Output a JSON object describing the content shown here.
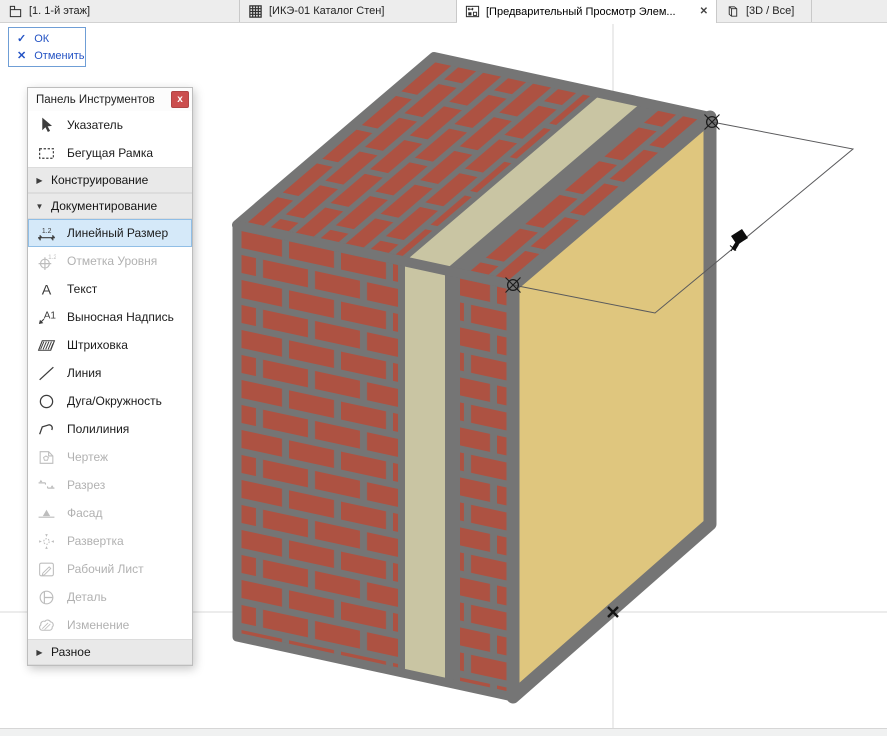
{
  "glyphs": {
    "check": "✓",
    "cross": "✕",
    "collapsed": "▶",
    "expanded": "▼",
    "close_x": "x",
    "tab_close": "✕"
  },
  "colors": {
    "brick": "#ad5242",
    "mortar": "#757575",
    "beige": "#c9c5a3",
    "yellowface": "#dfc67e",
    "guide": "#d9d9d9",
    "rubber": "#5a5a5c",
    "blue": "#2453c4",
    "selbg": "#d5e9f9",
    "selborder": "#90bee6",
    "closered": "#cb4e4e"
  },
  "tab_bar": {
    "tabs": [
      {
        "name": "floor-plan",
        "label": "[1. 1-й этаж]",
        "icon": "story-icon",
        "symbol": "i-story",
        "active": false,
        "closable": false
      },
      {
        "name": "wall-catalog",
        "label": "[ИКЭ-01 Каталог Стен]",
        "icon": "schedule-grid-icon",
        "symbol": "i-grid",
        "active": false,
        "closable": false
      },
      {
        "name": "element-preview",
        "label": "[Предварительный Просмотр Элем...",
        "icon": "preview-icon",
        "symbol": "i-preview",
        "active": true,
        "closable": true
      },
      {
        "name": "3d-all",
        "label": "[3D / Все]",
        "icon": "3d-view-icon",
        "symbol": "i-3d",
        "active": false,
        "closable": false
      }
    ]
  },
  "confirm_popup": {
    "ok_label": "ОК",
    "cancel_label": "Отменить"
  },
  "tool_panel": {
    "title": "Панель Инструментов",
    "items": [
      {
        "type": "tool",
        "name": "pointer",
        "label": "Указатель",
        "icon": "pointer-icon",
        "symbol": "i-pointer",
        "enabled": true,
        "selected": false
      },
      {
        "type": "tool",
        "name": "marquee",
        "label": "Бегущая Рамка",
        "icon": "marquee-icon",
        "symbol": "i-marquee",
        "enabled": true,
        "selected": false
      },
      {
        "type": "section",
        "name": "design",
        "label": "Конструирование",
        "expanded": false
      },
      {
        "type": "section",
        "name": "documentation",
        "label": "Документирование",
        "expanded": true
      },
      {
        "type": "tool",
        "name": "linear-dimension",
        "label": "Линейный Размер",
        "icon": "linear-dimension-icon",
        "symbol": "i-lineardim",
        "enabled": true,
        "selected": true
      },
      {
        "type": "tool",
        "name": "level-dimension",
        "label": "Отметка Уровня",
        "icon": "level-dimension-icon",
        "symbol": "i-leveldim",
        "enabled": false,
        "selected": false
      },
      {
        "type": "tool",
        "name": "text",
        "label": "Текст",
        "icon": "text-icon",
        "symbol": "i-text",
        "enabled": true,
        "selected": false
      },
      {
        "type": "tool",
        "name": "label",
        "label": "Выносная Надпись",
        "icon": "label-icon",
        "symbol": "i-label",
        "enabled": true,
        "selected": false
      },
      {
        "type": "tool",
        "name": "fill",
        "label": "Штриховка",
        "icon": "hatch-icon",
        "symbol": "i-hatch",
        "enabled": true,
        "selected": false
      },
      {
        "type": "tool",
        "name": "line",
        "label": "Линия",
        "icon": "line-icon",
        "symbol": "i-line",
        "enabled": true,
        "selected": false
      },
      {
        "type": "tool",
        "name": "arc-circle",
        "label": "Дуга/Окружность",
        "icon": "circle-icon",
        "symbol": "i-circle",
        "enabled": true,
        "selected": false
      },
      {
        "type": "tool",
        "name": "polyline",
        "label": "Полилиния",
        "icon": "polyline-icon",
        "symbol": "i-polyline",
        "enabled": true,
        "selected": false
      },
      {
        "type": "tool",
        "name": "drawing",
        "label": "Чертеж",
        "icon": "drawing-icon",
        "symbol": "i-drawing",
        "enabled": false,
        "selected": false
      },
      {
        "type": "tool",
        "name": "section",
        "label": "Разрез",
        "icon": "section-marker-icon",
        "symbol": "i-section",
        "enabled": false,
        "selected": false
      },
      {
        "type": "tool",
        "name": "elevation",
        "label": "Фасад",
        "icon": "elevation-marker-icon",
        "symbol": "i-elev",
        "enabled": false,
        "selected": false
      },
      {
        "type": "tool",
        "name": "interior-elevation",
        "label": "Развертка",
        "icon": "interior-elevation-icon",
        "symbol": "i-unfold",
        "enabled": false,
        "selected": false
      },
      {
        "type": "tool",
        "name": "worksheet",
        "label": "Рабочий Лист",
        "icon": "worksheet-icon",
        "symbol": "i-worksheet",
        "enabled": false,
        "selected": false
      },
      {
        "type": "tool",
        "name": "detail",
        "label": "Деталь",
        "icon": "detail-icon",
        "symbol": "i-detail",
        "enabled": false,
        "selected": false
      },
      {
        "type": "tool",
        "name": "change",
        "label": "Изменение",
        "icon": "change-cloud-icon",
        "symbol": "i-change",
        "enabled": false,
        "selected": false
      },
      {
        "type": "section",
        "name": "misc",
        "label": "Разное",
        "expanded": false
      }
    ]
  }
}
